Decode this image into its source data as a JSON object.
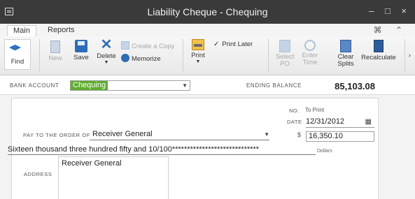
{
  "window": {
    "title": "Liability Cheque - Chequing",
    "controls": "– □ ×"
  },
  "tabs": [
    {
      "label": "Main"
    },
    {
      "label": "Reports"
    }
  ],
  "tab_controls": "⌘ ⌃",
  "toolbar": {
    "find_label": "Find",
    "new_label": "New",
    "save_label": "Save",
    "delete_label": "Delete",
    "create_copy_label": "Create a Copy",
    "memorize_label": "Memorize",
    "print_label": "Print",
    "print_later_label": "Print Later",
    "select_po_label": "Select PO",
    "enter_time_label": "Enter Time",
    "clear_splits_label": "Clear Splits",
    "recalculate_label": "Recalculate",
    "print_later_checked": true
  },
  "account": {
    "bank_account_label": "BANK ACCOUNT",
    "bank_account_value": "Chequing",
    "ending_balance_label": "ENDING BALANCE",
    "ending_balance_value": "85,103.08"
  },
  "cheque": {
    "no_label": "NO.",
    "no_value": "To Print",
    "date_label": "DATE",
    "date_value": "12/31/2012",
    "pay_to_label": "PAY TO THE ORDER OF",
    "payee": "Receiver General",
    "dollar_sign": "$",
    "amount": "16,350.10",
    "amount_words": "Sixteen thousand three hundred fifty and 10/100*****************************",
    "dollars_label": "Dollars",
    "address_label": "ADDRESS",
    "address_text": "Receiver General"
  },
  "colors": {
    "titlebar": "#3a3a3a",
    "account_highlight": "#5fae2e",
    "accent_blue": "#2e6db5"
  }
}
